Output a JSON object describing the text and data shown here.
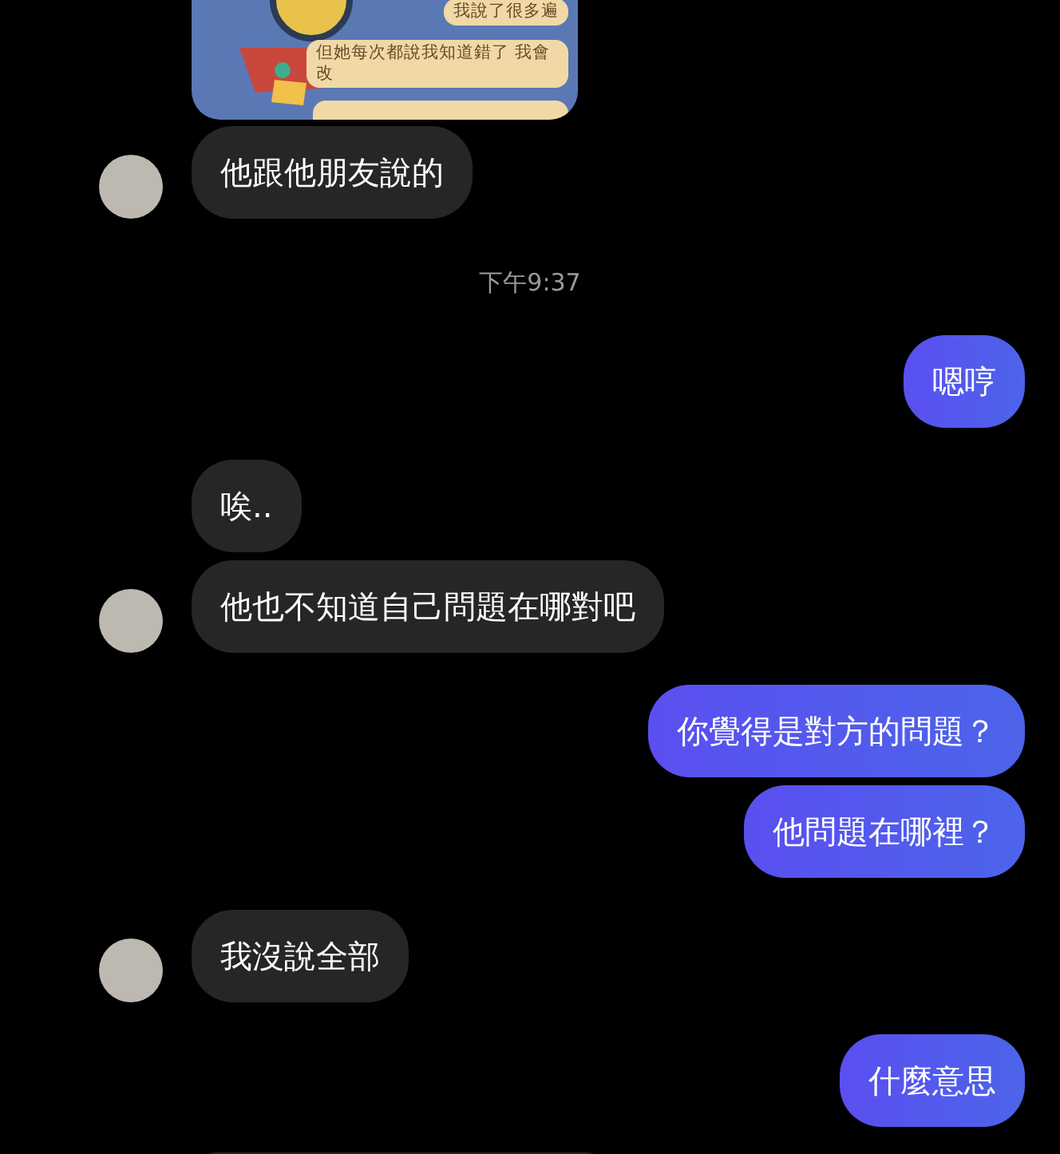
{
  "messages": [
    {
      "kind": "image",
      "avatar": false,
      "bubbles": [
        "我說了很多遍",
        "但她每次都說我知道錯了 我會改"
      ]
    },
    {
      "kind": "received",
      "avatar": true,
      "text": "他跟他朋友說的"
    },
    {
      "kind": "timestamp",
      "text": "下午9:37"
    },
    {
      "kind": "sent",
      "text": "嗯哼"
    },
    {
      "kind": "received",
      "avatar": false,
      "text": "唉.."
    },
    {
      "kind": "received",
      "avatar": true,
      "text": "他也不知道自己問題在哪對吧"
    },
    {
      "kind": "sent",
      "text": "你覺得是對方的問題？"
    },
    {
      "kind": "sent",
      "text": "他問題在哪裡？"
    },
    {
      "kind": "received",
      "avatar": true,
      "text": "我沒說全部"
    },
    {
      "kind": "sent",
      "text": "什麼意思"
    },
    {
      "kind": "partial",
      "avatar": false
    }
  ]
}
